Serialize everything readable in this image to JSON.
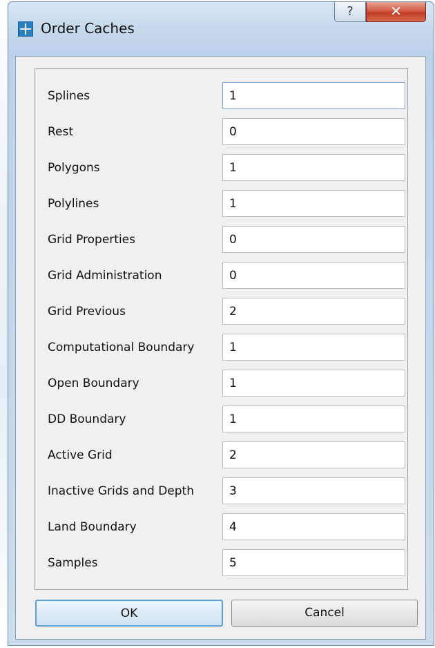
{
  "window": {
    "title": "Order Caches",
    "help_icon": "question-mark-icon",
    "close_icon": "close-x-icon"
  },
  "fields": [
    {
      "label": "Splines",
      "value": "1"
    },
    {
      "label": "Rest",
      "value": "0"
    },
    {
      "label": "Polygons",
      "value": "1"
    },
    {
      "label": "Polylines",
      "value": "1"
    },
    {
      "label": "Grid Properties",
      "value": "0"
    },
    {
      "label": "Grid Administration",
      "value": "0"
    },
    {
      "label": "Grid Previous",
      "value": "2"
    },
    {
      "label": "Computational Boundary",
      "value": "1"
    },
    {
      "label": "Open Boundary",
      "value": "1"
    },
    {
      "label": "DD Boundary",
      "value": "1"
    },
    {
      "label": "Active Grid",
      "value": "2"
    },
    {
      "label": "Inactive Grids and Depth",
      "value": "3"
    },
    {
      "label": "Land Boundary",
      "value": "4"
    },
    {
      "label": "Samples",
      "value": "5"
    }
  ],
  "buttons": {
    "ok_label": "OK",
    "cancel_label": "Cancel"
  }
}
